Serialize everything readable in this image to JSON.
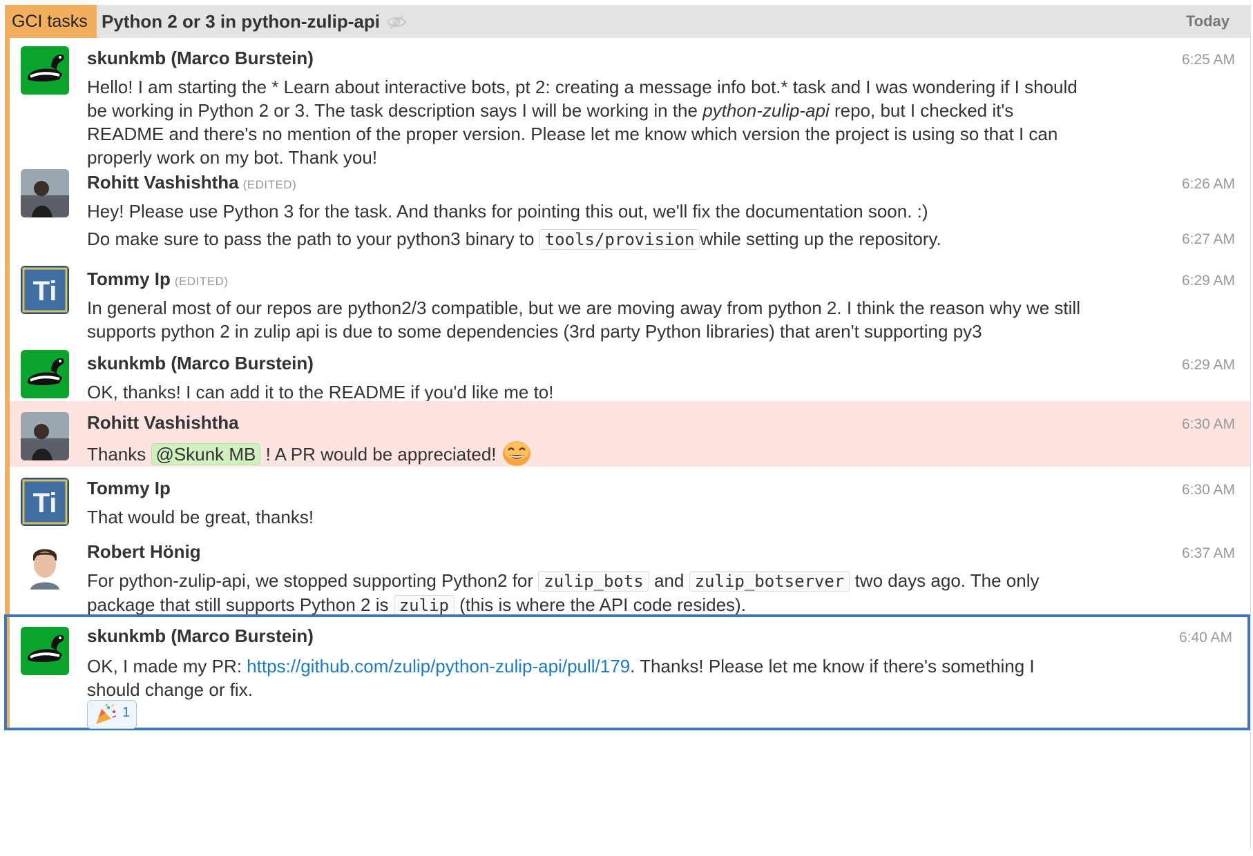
{
  "recipient": {
    "stream": "GCI tasks",
    "topic": "Python 2 or 3 in python-zulip-api",
    "date": "Today",
    "icons": [
      "mute-icon"
    ]
  },
  "colors": {
    "stream": "#f2b05e",
    "mention_row": "#fde4e1",
    "selected_border": "#4076b8",
    "link": "#1a7bc7"
  },
  "messages": [
    {
      "sender": "skunkmb (Marco Burstein)",
      "time": "6:25 AM",
      "text_1": "Hello! I am starting the * Learn about interactive bots, pt 2: creating a message info bot.* task and I was wondering if I should be working in Python 2 or 3. The task description says I will be working in the ",
      "text_em": "python-zulip-api",
      "text_2": " repo, but I checked it's README and there's no mention of the proper version. Please let me know which version the project is using so that I can properly work on my bot. Thank you!"
    },
    {
      "sender": "Rohitt Vashishtha",
      "edited": "(EDITED)",
      "time": "6:26 AM",
      "text": "Hey! Please use Python 3 for the task. And thanks for pointing this out, we'll fix the documentation soon. :)"
    },
    {
      "time": "6:27 AM",
      "text_1": "Do make sure to pass the path to your python3 binary to ",
      "code": "tools/provision",
      "text_2": "while setting up the repository."
    },
    {
      "sender": "Tommy Ip",
      "edited": "(EDITED)",
      "time": "6:29 AM",
      "text": "In general most of our repos are python2/3 compatible, but we are moving away from python 2. I think the reason why we still supports python 2 in zulip api is due to some dependencies (3rd party Python libraries) that aren't supporting py3"
    },
    {
      "sender": "skunkmb (Marco Burstein)",
      "time": "6:29 AM",
      "text": "OK, thanks! I can add it to the README if you'd like me to!"
    },
    {
      "sender": "Rohitt Vashishtha",
      "time": "6:30 AM",
      "text_1": "Thanks ",
      "mention": "@Skunk MB",
      "text_2": " ! A PR would be appreciated!",
      "emoji": "smile-emoji"
    },
    {
      "sender": "Tommy Ip",
      "time": "6:30 AM",
      "text": "That would be great, thanks!"
    },
    {
      "sender": "Robert Hönig",
      "time": "6:37 AM",
      "text_1": "For python-zulip-api, we stopped supporting Python2 for ",
      "code_1": "zulip_bots",
      "text_2": " and ",
      "code_2": "zulip_botserver",
      "text_3": " two days ago. The only package that still supports Python 2 is ",
      "code_3": "zulip",
      "text_4": " (this is where the API code resides)."
    },
    {
      "sender": "skunkmb (Marco Burstein)",
      "time": "6:40 AM",
      "text_1": "OK, I made my PR: ",
      "link": "https://github.com/zulip/python-zulip-api/pull/179",
      "text_2": ". Thanks! Please let me know if there's something I should change or fix.",
      "reaction": {
        "emoji": "tada-emoji",
        "count": "1"
      }
    }
  ]
}
